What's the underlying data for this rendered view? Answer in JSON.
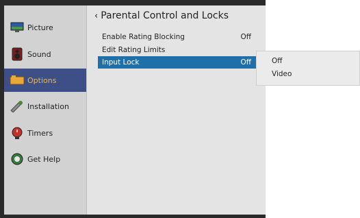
{
  "sidebar": {
    "items": [
      {
        "label": "Picture",
        "icon": "picture-icon"
      },
      {
        "label": "Sound",
        "icon": "speaker-icon"
      },
      {
        "label": "Options",
        "icon": "options-icon",
        "active": true
      },
      {
        "label": "Installation",
        "icon": "wrench-icon"
      },
      {
        "label": "Timers",
        "icon": "timer-icon"
      },
      {
        "label": "Get Help",
        "icon": "help-icon"
      }
    ]
  },
  "main": {
    "title": "Parental Control and Locks",
    "back_glyph": "‹",
    "rows": [
      {
        "label": "Enable Rating Blocking",
        "value": "Off"
      },
      {
        "label": "Edit Rating Limits",
        "value": ""
      },
      {
        "label": "Input Lock",
        "value": "Off",
        "selected": true
      }
    ]
  },
  "popup": {
    "options": [
      "Off",
      "Video"
    ]
  },
  "colors": {
    "active_sidebar_bg": "#3d4f86",
    "active_sidebar_text": "#e8ba4a",
    "selected_row_bg": "#1f6fa8"
  }
}
